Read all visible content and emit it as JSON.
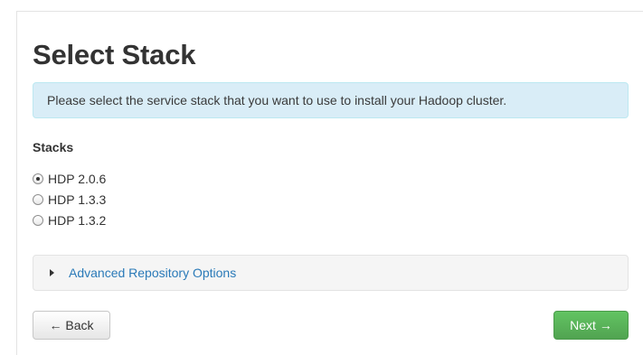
{
  "page": {
    "title": "Select Stack",
    "info_message": "Please select the service stack that you want to use to install your Hadoop cluster."
  },
  "stacks": {
    "label": "Stacks",
    "options": [
      {
        "label": "HDP 2.0.6",
        "selected": true
      },
      {
        "label": "HDP 1.3.3",
        "selected": false
      },
      {
        "label": "HDP 1.3.2",
        "selected": false
      }
    ]
  },
  "advanced": {
    "label": "Advanced Repository Options",
    "icon": "caret-right-icon",
    "expanded": false
  },
  "nav": {
    "back_label": "← Back",
    "next_label": "Next →"
  },
  "colors": {
    "info_bg": "#d9edf7",
    "link": "#2a7ab8",
    "next_button": "#5bb75b"
  }
}
